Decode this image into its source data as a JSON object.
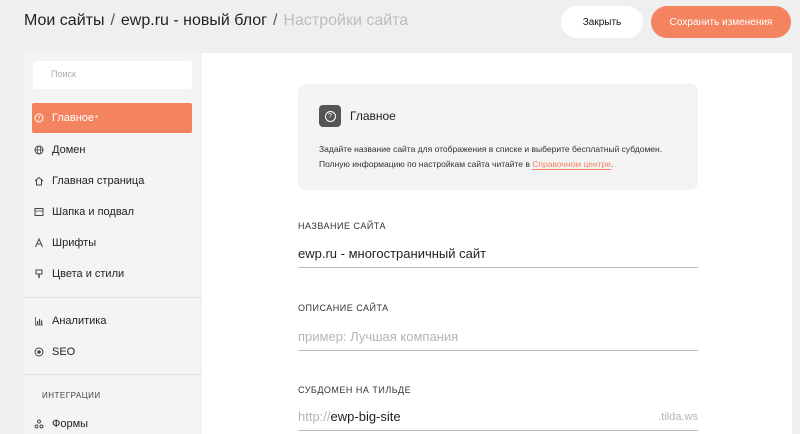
{
  "breadcrumb": {
    "root": "Мои сайты",
    "project": "ewp.ru - новый блог",
    "current": "Настройки сайта",
    "separator": "/"
  },
  "header": {
    "close_label": "Закрыть",
    "save_label": "Сохранить изменения"
  },
  "sidebar": {
    "search_placeholder": "Поиск",
    "items": [
      {
        "label": "Главное",
        "icon": "question-circle-icon",
        "active": true,
        "marker": "*"
      },
      {
        "label": "Домен",
        "icon": "globe-icon"
      },
      {
        "label": "Главная страница",
        "icon": "home-icon"
      },
      {
        "label": "Шапка и подвал",
        "icon": "layout-icon"
      },
      {
        "label": "Шрифты",
        "icon": "font-icon"
      },
      {
        "label": "Цвета и стили",
        "icon": "brush-icon"
      },
      {
        "label": "Аналитика",
        "icon": "bar-chart-icon"
      },
      {
        "label": "SEO",
        "icon": "target-icon"
      },
      {
        "label": "Формы",
        "icon": "forms-icon"
      }
    ],
    "integrations_label": "ИНТЕГРАЦИИ"
  },
  "main": {
    "info": {
      "title": "Главное",
      "desc_line1": "Задайте название сайта для отображения в списке и выберите бесплатный субдомен.",
      "desc_line2": "Полную информацию по настройкам сайта читайте в",
      "link": "Справочном центре",
      "desc_end": "."
    },
    "site_name": {
      "label": "НАЗВАНИЕ САЙТА",
      "value": "ewp.ru - многостраничный сайт"
    },
    "site_desc": {
      "label": "ОПИСАНИЕ САЙТА",
      "placeholder": "пример: Лучшая компания"
    },
    "subdomain": {
      "label": "СУБДОМЕН НА ТИЛЬДЕ",
      "prefix": "http://",
      "value": "ewp-big-site",
      "suffix": ".tilda.ws"
    }
  },
  "colors": {
    "accent": "#f4845f",
    "background": "#efefef",
    "panel": "#ffffff"
  }
}
